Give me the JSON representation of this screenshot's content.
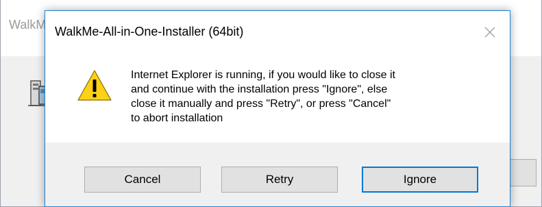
{
  "background_window": {
    "title_partial": "WalkM",
    "icon": "installer-icon"
  },
  "dialog": {
    "title": "WalkMe-All-in-One-Installer (64bit)",
    "close_icon": "close-icon",
    "warning_icon": "warning-icon",
    "message": "Internet Explorer is running, if you would like to close it\nand continue with the installation press \"Ignore\", else\nclose it manually and press \"Retry\", or press \"Cancel\"\nto abort installation",
    "buttons": {
      "cancel": "Cancel",
      "retry": "Retry",
      "ignore": "Ignore"
    },
    "colors": {
      "accent_border": "#1883d7",
      "default_button_border": "#0078d7",
      "footer_bg": "#f0f0f0",
      "warning_fill": "#fcd116"
    }
  }
}
